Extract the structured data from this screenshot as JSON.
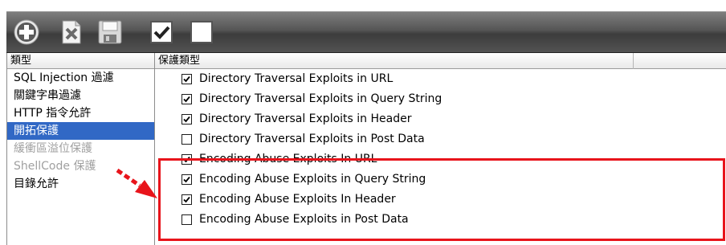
{
  "toolbar": {
    "add_icon": "add-icon",
    "delete_icon": "delete-document-icon",
    "save_icon": "save-icon",
    "check_all_icon": "checkbox-checked-icon",
    "uncheck_all_icon": "checkbox-empty-icon"
  },
  "types_column": {
    "header": "類型",
    "items": [
      {
        "label": "SQL Injection 過濾",
        "state": "normal"
      },
      {
        "label": "關鍵字串過濾",
        "state": "normal"
      },
      {
        "label": "HTTP 指令允許",
        "state": "normal"
      },
      {
        "label": "開拓保護",
        "state": "selected"
      },
      {
        "label": "緩衝區溢位保護",
        "state": "disabled"
      },
      {
        "label": "ShellCode 保護",
        "state": "disabled"
      },
      {
        "label": "目錄允許",
        "state": "normal"
      }
    ]
  },
  "protection_column": {
    "header": "保護類型",
    "items": [
      {
        "label": "Directory Traversal Exploits in URL",
        "checked": true
      },
      {
        "label": "Directory Traversal Exploits in Query String",
        "checked": true
      },
      {
        "label": "Directory Traversal Exploits in Header",
        "checked": true
      },
      {
        "label": "Directory Traversal Exploits in Post Data",
        "checked": false
      },
      {
        "label": "Encoding Abuse Exploits In URL",
        "checked": true
      },
      {
        "label": "Encoding Abuse Exploits in Query String",
        "checked": true
      },
      {
        "label": "Encoding Abuse Exploits In Header",
        "checked": true
      },
      {
        "label": "Encoding Abuse Exploits in Post Data",
        "checked": false
      }
    ]
  },
  "colors": {
    "selection": "#3168c5",
    "highlight": "#e8141b",
    "toolbar": "#4a4a4a"
  }
}
